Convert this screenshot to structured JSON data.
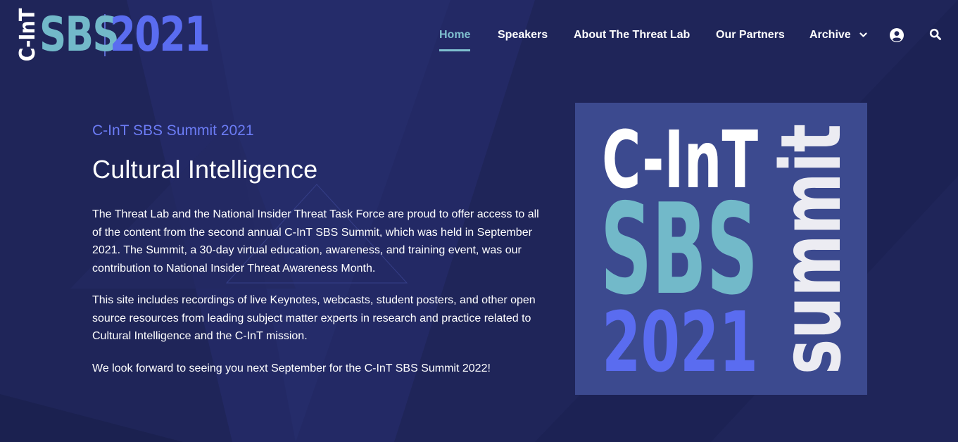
{
  "logo": {
    "vertical_text": "C-InT",
    "sbs": "SBS",
    "year": "2021"
  },
  "nav": {
    "items": [
      {
        "label": "Home",
        "active": true
      },
      {
        "label": "Speakers",
        "active": false
      },
      {
        "label": "About The Threat Lab",
        "active": false
      },
      {
        "label": "Our Partners",
        "active": false
      },
      {
        "label": "Archive",
        "active": false,
        "has_dropdown": true
      }
    ],
    "account_icon": "user-circle-icon",
    "search_icon": "search-icon"
  },
  "hero": {
    "eyebrow": "C-InT SBS Summit 2021",
    "title": "Cultural Intelligence",
    "paragraphs": [
      "The Threat Lab and the National Insider Threat Task Force are proud to offer access to all of the content from the second annual C-InT SBS Summit, which was held in September 2021. The Summit, a 30-day virtual education, awareness, and training event, was our contribution to National Insider Threat Awareness Month.",
      "This site includes recordings of live Keynotes, webcasts, student posters, and other open source resources from leading subject matter experts in research and practice related to Cultural Intelligence and the C-InT mission.",
      "We look forward to seeing you next September for the C-InT SBS Summit 2022!"
    ]
  },
  "summit_graphic": {
    "line1": "C-InT",
    "line2": "SBS",
    "line3": "2021",
    "vertical": "summit"
  },
  "colors": {
    "background": "#1f2559",
    "accent_teal": "#72b9c9",
    "accent_blue": "#5a6cf0",
    "eyebrow": "#6c7cf5",
    "graphic_bg": "#3c4a8f"
  }
}
